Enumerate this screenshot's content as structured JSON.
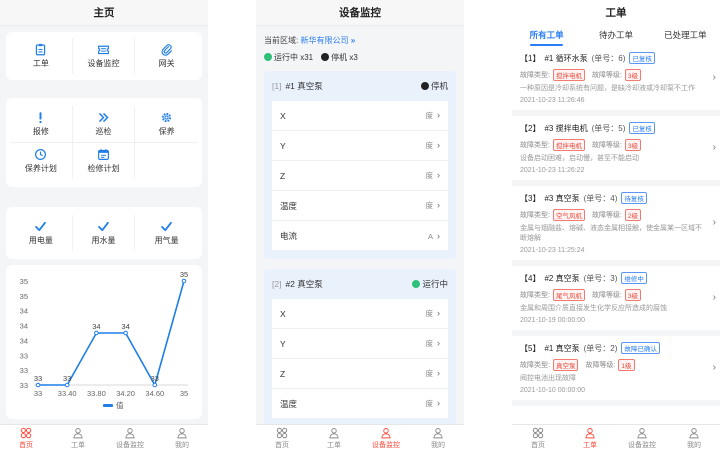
{
  "home": {
    "title": "主页",
    "grid1": [
      {
        "label": "工单",
        "icon": "clipboard-icon"
      },
      {
        "label": "设备监控",
        "icon": "ticket-icon"
      },
      {
        "label": "网关",
        "icon": "paperclip-icon"
      }
    ],
    "grid2": [
      {
        "label": "报修",
        "icon": "exclamation-icon"
      },
      {
        "label": "巡检",
        "icon": "double-chevron-icon"
      },
      {
        "label": "保养",
        "icon": "gear-icon"
      },
      {
        "label": "保养计划",
        "icon": "clock-icon"
      },
      {
        "label": "检修计划",
        "icon": "calendar-icon"
      }
    ],
    "grid3": [
      {
        "label": "用电量",
        "icon": "check-icon"
      },
      {
        "label": "用水量",
        "icon": "check-icon"
      },
      {
        "label": "用气量",
        "icon": "check-icon"
      }
    ]
  },
  "chart_data": {
    "type": "line",
    "categories": [
      "33",
      "33.40",
      "33.80",
      "34.20",
      "34.60",
      "35"
    ],
    "series": [
      {
        "name": "值",
        "values": [
          33,
          33,
          34,
          34,
          33,
          35
        ],
        "color": "#1f7ee8"
      }
    ],
    "data_labels": [
      "33",
      "33",
      "34",
      "34",
      "33",
      "35"
    ],
    "yticks": [
      "35",
      "35",
      "34",
      "34",
      "34",
      "33",
      "33",
      "33"
    ],
    "ylim": [
      33,
      35
    ],
    "grid": false,
    "legend": "bottom"
  },
  "monitor": {
    "title": "设备监控",
    "region_label": "当前区域:",
    "region_value": "新华有限公司",
    "running": "运行中 x31",
    "stopped": "停机 x3",
    "devices": [
      {
        "index": "[1]",
        "name": "#1 真空泵",
        "status": "停机",
        "status_color": "#222222",
        "params": [
          {
            "name": "X",
            "unit": "度"
          },
          {
            "name": "Y",
            "unit": "度"
          },
          {
            "name": "Z",
            "unit": "度"
          },
          {
            "name": "温度",
            "unit": "度"
          },
          {
            "name": "电流",
            "unit": "A"
          }
        ]
      },
      {
        "index": "[2]",
        "name": "#2 真空泵",
        "status": "运行中",
        "status_color": "#2fc07a",
        "params": [
          {
            "name": "X",
            "unit": "度"
          },
          {
            "name": "Y",
            "unit": "度"
          },
          {
            "name": "Z",
            "unit": "度"
          },
          {
            "name": "温度",
            "unit": "度"
          }
        ]
      }
    ]
  },
  "workorders": {
    "title": "工单",
    "tabs": [
      "所有工单",
      "待办工单",
      "已处理工单"
    ],
    "type_label": "故障类型:",
    "level_label": "故障等级:",
    "items": [
      {
        "head": "【1】",
        "name": "#1 循环水泵",
        "no": "(单号：6)",
        "state": "已复核",
        "type": "搅拌电机",
        "level": "3级",
        "desc": "一种原因是冷却系统有问题，是缺冷却液或冷却泵不工作",
        "time": "2021-10-23 11:26:46"
      },
      {
        "head": "【2】",
        "name": "#3 搅拌电机",
        "no": "(单号：5)",
        "state": "已复核",
        "type": "搅拌电机",
        "level": "3级",
        "desc": "设备启动困难，启动慢，甚至不能启动",
        "time": "2021-10-23 11:26:22"
      },
      {
        "head": "【3】",
        "name": "#3 真空泵",
        "no": "(单号：4)",
        "state": "待复核",
        "type": "空气风机",
        "level": "2级",
        "desc": "金属与烟融盐、熔碱、液态金属相接触，使金属某一区域不断熔解",
        "time": "2021-10-23 11:25:24"
      },
      {
        "head": "【4】",
        "name": "#2 真空泵",
        "no": "(单号：3)",
        "state": "维修中",
        "type": "尾气风机",
        "level": "3级",
        "desc": "金属和周围介质直接发生化学反应所造成的腐蚀",
        "time": "2021-10-19 00:00:00"
      },
      {
        "head": "【5】",
        "name": "#1 真空泵",
        "no": "(单号：2)",
        "state": "故障已确认",
        "type": "真空泵",
        "level": "1级",
        "desc": "阀控电池出现故障",
        "time": "2021-10-10 00:00:00"
      }
    ]
  },
  "tabbar": [
    "首页",
    "工单",
    "设备监控",
    "我的"
  ]
}
